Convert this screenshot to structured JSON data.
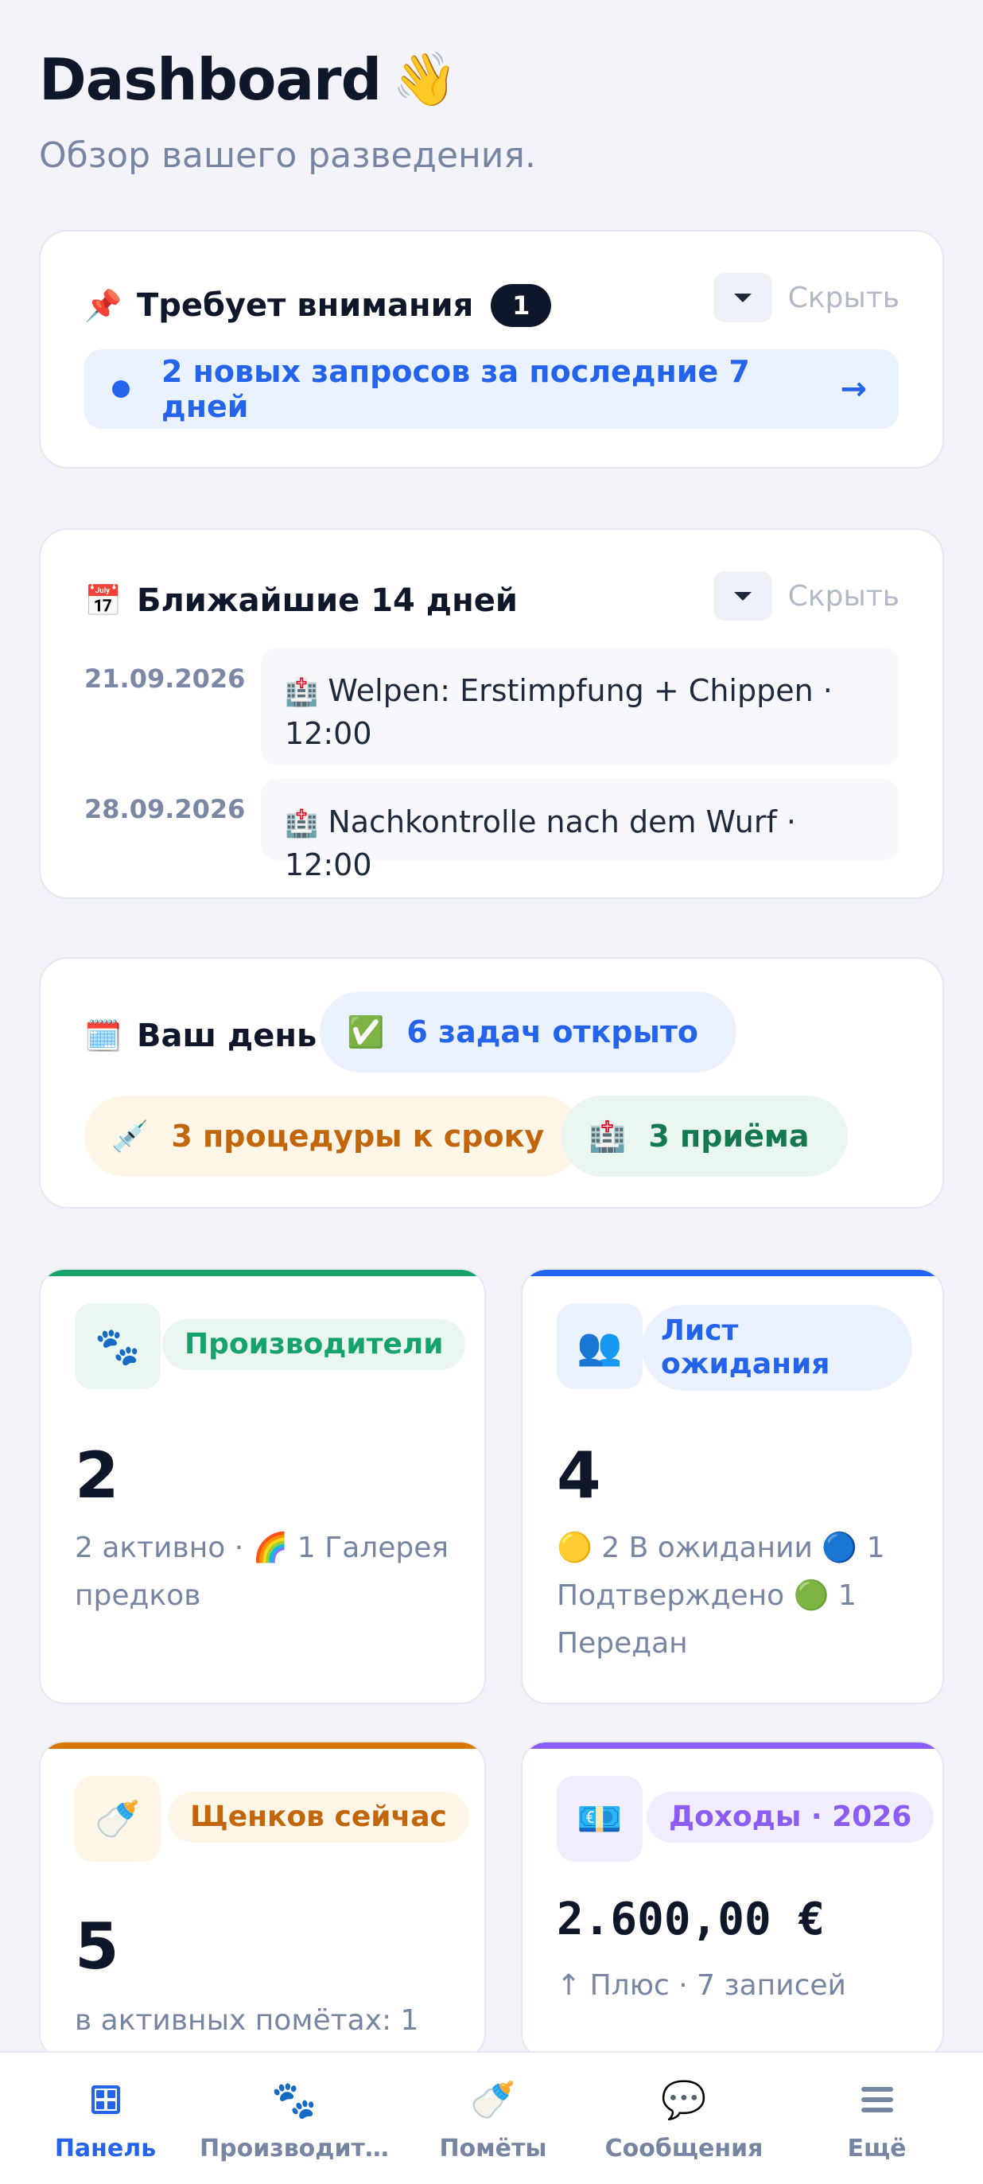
{
  "header": {
    "title": "Dashboard",
    "title_emoji": "👋",
    "subtitle": "Обзор вашего разведения."
  },
  "attention": {
    "emoji": "📌",
    "title": "Требует внимания",
    "count": "1",
    "hide_label": "Скрыть",
    "alert_text": "2 новых запросов за последние 7 дней",
    "alert_arrow": "→"
  },
  "upcoming": {
    "emoji": "📅",
    "title": "Ближайшие 14 дней",
    "hide_label": "Скрыть",
    "events": [
      {
        "date": "21.09.2026",
        "emoji": "🏥",
        "text": "Welpen: Erstimpfung + Chippen · 12:00"
      },
      {
        "date": "28.09.2026",
        "emoji": "🏥",
        "text": "Nachkontrolle nach dem Wurf · 12:00"
      }
    ]
  },
  "your_day": {
    "emoji": "🗓️",
    "title": "Ваш день",
    "pills": [
      {
        "emoji": "✅",
        "text": "6 задач открыто",
        "color": "#2463eb",
        "bg": "#ebf2ff"
      },
      {
        "emoji": "💉",
        "text": "3 процедуры к сроку",
        "color": "#c2660c",
        "bg": "#fff6e8"
      },
      {
        "emoji": "🏥",
        "text": "3 приёма",
        "color": "#15794f",
        "bg": "#eaf7f0"
      }
    ]
  },
  "stats": {
    "sires": {
      "icon": "🐾",
      "tag": "Производители",
      "value": "2",
      "desc": "2 активно · 🌈 1 Галерея предков",
      "accent": "#16a36b"
    },
    "waitlist": {
      "icon": "👥",
      "tag": "Лист ожидания",
      "value": "4",
      "desc": "🟡 2 В ожидании 🔵 1 Подтверждено 🟢 1 Передан",
      "accent": "#2463eb"
    },
    "puppies": {
      "icon": "🍼",
      "tag": "Щенков сейчас",
      "value": "5",
      "desc": "в активных помётах: 1",
      "accent": "#d97706"
    },
    "income": {
      "icon": "💶",
      "tag": "Доходы · 2026",
      "value": "2.600,00 €",
      "desc": "↑ Плюс · 7 записей",
      "accent": "#8b5cf6"
    }
  },
  "nav": {
    "items": [
      {
        "icon": "grid-icon",
        "label": "Панель",
        "active": true
      },
      {
        "icon": "🐾",
        "label": "Производит…"
      },
      {
        "icon": "🍼",
        "label": "Помёты"
      },
      {
        "icon": "💬",
        "label": "Сообщения"
      },
      {
        "icon": "menu-icon",
        "label": "Ещё"
      }
    ]
  }
}
